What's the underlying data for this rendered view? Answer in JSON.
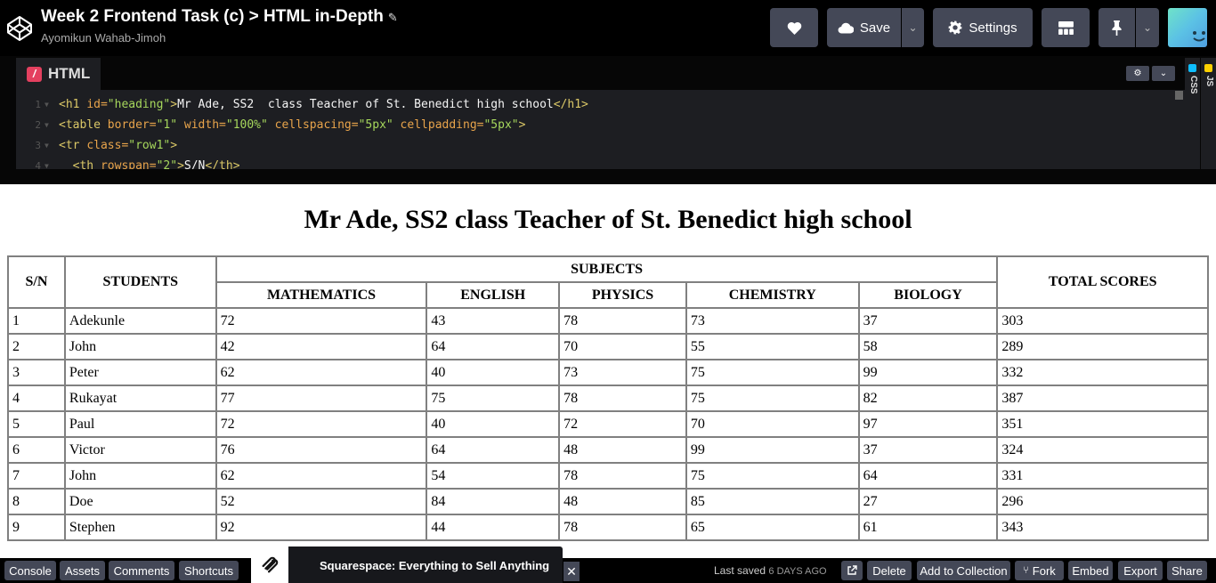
{
  "header": {
    "title": "Week 2 Frontend Task (c) > HTML in-Depth",
    "author": "Ayomikun Wahab-Jimoh",
    "save_label": "Save",
    "settings_label": "Settings"
  },
  "editor": {
    "tab_label": "HTML",
    "badge_letter": "/",
    "side_tabs": {
      "css": "CSS",
      "js": "JS"
    },
    "lines": [
      {
        "n": "1",
        "html": "<span class='tg'>&lt;h1 </span><span class='at'>id=</span><span class='sv'>\"heading\"</span><span class='tg'>&gt;</span><span class='ct'>Mr Ade, SS2  class Teacher of St. Benedict high school</span><span class='tg'>&lt;/h1&gt;</span>"
      },
      {
        "n": "2",
        "html": "<span class='tg'>&lt;table </span><span class='at'>border=</span><span class='sv'>\"1\"</span><span class='at'> width=</span><span class='sv'>\"100%\"</span><span class='at'> cellspacing=</span><span class='sv'>\"5px\"</span><span class='at'> cellpadding=</span><span class='sv'>\"5px\"</span><span class='tg'>&gt;</span>"
      },
      {
        "n": "3",
        "html": "<span class='tg'>&lt;tr </span><span class='at'>class=</span><span class='sv'>\"row1\"</span><span class='tg'>&gt;</span>"
      },
      {
        "n": "4",
        "html": "<span class='tg'>  &lt;th </span><span class='at'>rowspan=</span><span class='sv'>\"2\"</span><span class='tg'>&gt;</span><span class='ct'>S/N</span><span class='tg'>&lt;/th&gt;</span>"
      }
    ]
  },
  "preview": {
    "heading": "Mr Ade, SS2 class Teacher of St. Benedict high school",
    "headers": {
      "sn": "S/N",
      "students": "STUDENTS",
      "subjects": "SUBJECTS",
      "total": "TOTAL SCORES",
      "subjects_list": [
        "MATHEMATICS",
        "ENGLISH",
        "PHYSICS",
        "CHEMISTRY",
        "BIOLOGY"
      ]
    },
    "rows": [
      [
        "1",
        "Adekunle",
        "72",
        "43",
        "78",
        "73",
        "37",
        "303"
      ],
      [
        "2",
        "John",
        "42",
        "64",
        "70",
        "55",
        "58",
        "289"
      ],
      [
        "3",
        "Peter",
        "62",
        "40",
        "73",
        "75",
        "99",
        "332"
      ],
      [
        "4",
        "Rukayat",
        "77",
        "75",
        "78",
        "75",
        "82",
        "387"
      ],
      [
        "5",
        "Paul",
        "72",
        "40",
        "72",
        "70",
        "97",
        "351"
      ],
      [
        "6",
        "Victor",
        "76",
        "64",
        "48",
        "99",
        "37",
        "324"
      ],
      [
        "7",
        "John",
        "62",
        "54",
        "78",
        "75",
        "64",
        "331"
      ],
      [
        "8",
        "Doe",
        "52",
        "84",
        "48",
        "85",
        "27",
        "296"
      ],
      [
        "9",
        "Stephen",
        "92",
        "44",
        "78",
        "65",
        "61",
        "343"
      ]
    ]
  },
  "footer": {
    "console": "Console",
    "assets": "Assets",
    "comments": "Comments",
    "shortcuts": "Shortcuts",
    "ad_text": "Squarespace: Everything to Sell Anything",
    "last_saved_label": "Last saved",
    "last_saved_when": "6 DAYS AGO",
    "delete": "Delete",
    "add_to_collection": "Add to Collection",
    "fork": "Fork",
    "embed": "Embed",
    "export": "Export",
    "share": "Share"
  },
  "colors": {
    "header_bg": "#000000",
    "button_bg": "#444857",
    "editor_bg": "#1d1e22",
    "html_badge": "#e4405f",
    "css_badge": "#0ebeff",
    "js_badge": "#fcd000"
  }
}
